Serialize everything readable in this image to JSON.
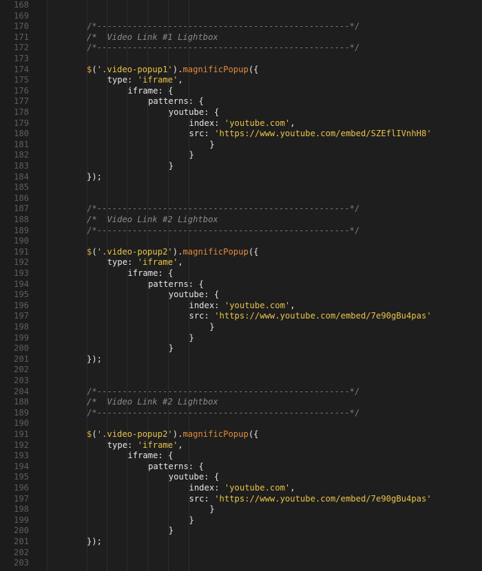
{
  "editor": {
    "lines": [
      {
        "n": "168",
        "indent": 0,
        "tokens": []
      },
      {
        "n": "169",
        "indent": 0,
        "tokens": []
      },
      {
        "n": "170",
        "indent": 0,
        "tokens": [
          {
            "t": "/*--------------------------------------------------*/",
            "c": "comment"
          }
        ]
      },
      {
        "n": "171",
        "indent": 0,
        "tokens": [
          {
            "t": "/*  Video Link #1 Lightbox",
            "c": "comment-it"
          }
        ]
      },
      {
        "n": "172",
        "indent": 0,
        "tokens": [
          {
            "t": "/*--------------------------------------------------*/",
            "c": "comment"
          }
        ]
      },
      {
        "n": "173",
        "indent": 0,
        "tokens": []
      },
      {
        "n": "174",
        "indent": 0,
        "tokens": [
          {
            "t": "$",
            "c": "dollar"
          },
          {
            "t": "(",
            "c": "punc"
          },
          {
            "t": "'.video-popup1'",
            "c": "str"
          },
          {
            "t": ").",
            "c": "punc"
          },
          {
            "t": "magnificPopup",
            "c": "fn"
          },
          {
            "t": "({",
            "c": "punc"
          }
        ]
      },
      {
        "n": "175",
        "indent": 1,
        "tokens": [
          {
            "t": "type: ",
            "c": "key"
          },
          {
            "t": "'iframe'",
            "c": "str"
          },
          {
            "t": ",",
            "c": "punc"
          }
        ]
      },
      {
        "n": "176",
        "indent": 2,
        "tokens": [
          {
            "t": "iframe: {",
            "c": "key"
          }
        ]
      },
      {
        "n": "177",
        "indent": 3,
        "tokens": [
          {
            "t": "patterns: {",
            "c": "key"
          }
        ]
      },
      {
        "n": "178",
        "indent": 4,
        "tokens": [
          {
            "t": "youtube: {",
            "c": "key"
          }
        ]
      },
      {
        "n": "179",
        "indent": 5,
        "tokens": [
          {
            "t": "index: ",
            "c": "key"
          },
          {
            "t": "'youtube.com'",
            "c": "str"
          },
          {
            "t": ",",
            "c": "punc"
          }
        ]
      },
      {
        "n": "180",
        "indent": 5,
        "tokens": [
          {
            "t": "src: ",
            "c": "key"
          },
          {
            "t": "'https://www.youtube.com/embed/SZEflIVnhH8'",
            "c": "str"
          }
        ]
      },
      {
        "n": "181",
        "indent": 6,
        "tokens": [
          {
            "t": "}",
            "c": "punc"
          }
        ]
      },
      {
        "n": "182",
        "indent": 5,
        "tokens": [
          {
            "t": "}",
            "c": "punc"
          }
        ]
      },
      {
        "n": "183",
        "indent": 4,
        "tokens": [
          {
            "t": "}",
            "c": "punc"
          }
        ]
      },
      {
        "n": "184",
        "indent": 0,
        "tokens": [
          {
            "t": "});",
            "c": "punc"
          }
        ]
      },
      {
        "n": "185",
        "indent": 0,
        "tokens": []
      },
      {
        "n": "186",
        "indent": 0,
        "tokens": []
      },
      {
        "n": "187",
        "indent": 0,
        "tokens": [
          {
            "t": "/*--------------------------------------------------*/",
            "c": "comment"
          }
        ]
      },
      {
        "n": "188",
        "indent": 0,
        "tokens": [
          {
            "t": "/*  Video Link #2 Lightbox",
            "c": "comment-it"
          }
        ]
      },
      {
        "n": "189",
        "indent": 0,
        "tokens": [
          {
            "t": "/*--------------------------------------------------*/",
            "c": "comment"
          }
        ]
      },
      {
        "n": "190",
        "indent": 0,
        "tokens": []
      },
      {
        "n": "191",
        "indent": 0,
        "tokens": [
          {
            "t": "$",
            "c": "dollar"
          },
          {
            "t": "(",
            "c": "punc"
          },
          {
            "t": "'.video-popup2'",
            "c": "str"
          },
          {
            "t": ").",
            "c": "punc"
          },
          {
            "t": "magnificPopup",
            "c": "fn"
          },
          {
            "t": "({",
            "c": "punc"
          }
        ]
      },
      {
        "n": "192",
        "indent": 1,
        "tokens": [
          {
            "t": "type: ",
            "c": "key"
          },
          {
            "t": "'iframe'",
            "c": "str"
          },
          {
            "t": ",",
            "c": "punc"
          }
        ]
      },
      {
        "n": "193",
        "indent": 2,
        "tokens": [
          {
            "t": "iframe: {",
            "c": "key"
          }
        ]
      },
      {
        "n": "194",
        "indent": 3,
        "tokens": [
          {
            "t": "patterns: {",
            "c": "key"
          }
        ]
      },
      {
        "n": "195",
        "indent": 4,
        "tokens": [
          {
            "t": "youtube: {",
            "c": "key"
          }
        ]
      },
      {
        "n": "196",
        "indent": 5,
        "tokens": [
          {
            "t": "index: ",
            "c": "key"
          },
          {
            "t": "'youtube.com'",
            "c": "str"
          },
          {
            "t": ",",
            "c": "punc"
          }
        ]
      },
      {
        "n": "197",
        "indent": 5,
        "tokens": [
          {
            "t": "src: ",
            "c": "key"
          },
          {
            "t": "'https://www.youtube.com/embed/7e90gBu4pas'",
            "c": "str"
          }
        ]
      },
      {
        "n": "198",
        "indent": 6,
        "tokens": [
          {
            "t": "}",
            "c": "punc"
          }
        ]
      },
      {
        "n": "199",
        "indent": 5,
        "tokens": [
          {
            "t": "}",
            "c": "punc"
          }
        ]
      },
      {
        "n": "200",
        "indent": 4,
        "tokens": [
          {
            "t": "}",
            "c": "punc"
          }
        ]
      },
      {
        "n": "201",
        "indent": 0,
        "tokens": [
          {
            "t": "});",
            "c": "punc"
          }
        ]
      },
      {
        "n": "202",
        "indent": 0,
        "tokens": []
      },
      {
        "n": "203",
        "indent": 0,
        "tokens": []
      },
      {
        "n": "204",
        "indent": 0,
        "tokens": [
          {
            "t": "/*--------------------------------------------------*/",
            "c": "comment"
          }
        ]
      },
      {
        "n": "188",
        "indent": 0,
        "tokens": [
          {
            "t": "/*  Video Link #2 Lightbox",
            "c": "comment-it"
          }
        ]
      },
      {
        "n": "189",
        "indent": 0,
        "tokens": [
          {
            "t": "/*--------------------------------------------------*/",
            "c": "comment"
          }
        ]
      },
      {
        "n": "190",
        "indent": 0,
        "tokens": []
      },
      {
        "n": "191",
        "indent": 0,
        "tokens": [
          {
            "t": "$",
            "c": "dollar"
          },
          {
            "t": "(",
            "c": "punc"
          },
          {
            "t": "'.video-popup2'",
            "c": "str"
          },
          {
            "t": ").",
            "c": "punc"
          },
          {
            "t": "magnificPopup",
            "c": "fn"
          },
          {
            "t": "({",
            "c": "punc"
          }
        ]
      },
      {
        "n": "192",
        "indent": 1,
        "tokens": [
          {
            "t": "type: ",
            "c": "key"
          },
          {
            "t": "'iframe'",
            "c": "str"
          },
          {
            "t": ",",
            "c": "punc"
          }
        ]
      },
      {
        "n": "193",
        "indent": 2,
        "tokens": [
          {
            "t": "iframe: {",
            "c": "key"
          }
        ]
      },
      {
        "n": "194",
        "indent": 3,
        "tokens": [
          {
            "t": "patterns: {",
            "c": "key"
          }
        ]
      },
      {
        "n": "195",
        "indent": 4,
        "tokens": [
          {
            "t": "youtube: {",
            "c": "key"
          }
        ]
      },
      {
        "n": "196",
        "indent": 5,
        "tokens": [
          {
            "t": "index: ",
            "c": "key"
          },
          {
            "t": "'youtube.com'",
            "c": "str"
          },
          {
            "t": ",",
            "c": "punc"
          }
        ]
      },
      {
        "n": "197",
        "indent": 5,
        "tokens": [
          {
            "t": "src: ",
            "c": "key"
          },
          {
            "t": "'https://www.youtube.com/embed/7e90gBu4pas'",
            "c": "str"
          }
        ]
      },
      {
        "n": "198",
        "indent": 6,
        "tokens": [
          {
            "t": "}",
            "c": "punc"
          }
        ]
      },
      {
        "n": "199",
        "indent": 5,
        "tokens": [
          {
            "t": "}",
            "c": "punc"
          }
        ]
      },
      {
        "n": "200",
        "indent": 4,
        "tokens": [
          {
            "t": "}",
            "c": "punc"
          }
        ]
      },
      {
        "n": "201",
        "indent": 0,
        "tokens": [
          {
            "t": "});",
            "c": "punc"
          }
        ]
      },
      {
        "n": "202",
        "indent": 0,
        "tokens": []
      },
      {
        "n": "203",
        "indent": 0,
        "tokens": []
      }
    ]
  },
  "colors": {
    "background": "#1e1e1e",
    "line_number": "#5e5e5e",
    "comment": "#7c7c7c",
    "string": "#e9c44a",
    "function": "#e08b3c",
    "text": "#e6e6e6"
  }
}
